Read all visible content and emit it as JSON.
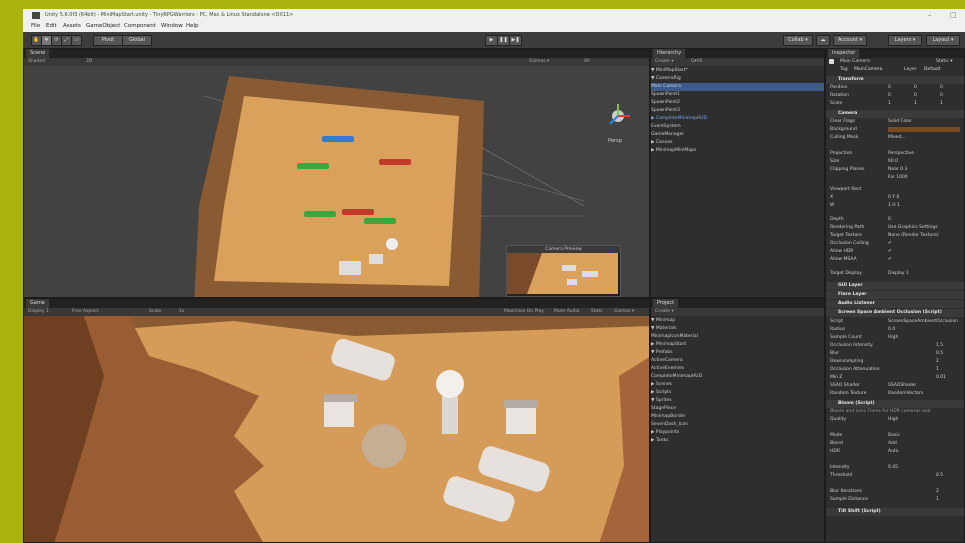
{
  "app": {
    "title": "Unity 5.6.0f3 (64bit) - MiniMapStart.unity - TinyRPGWarriors - PC, Mac & Linux Standalone <DX11>"
  },
  "window_controls": [
    "–",
    "□"
  ],
  "menu": [
    "File",
    "Edit",
    "Assets",
    "GameObject",
    "Component",
    "Window",
    "Help"
  ],
  "toolbar": {
    "pivot": "Pivot",
    "global": "Global",
    "collab": "Collab ▾",
    "cloud": "☁",
    "account": "Account ▾",
    "layers": "Layers ▾",
    "layout": "Layout ▾"
  },
  "scene": {
    "tab": "Scene",
    "shading": "Shaded",
    "mode_2d": "2D",
    "gizmos": "Gizmos ▾",
    "search": "All",
    "persp": "Persp",
    "preview_title": "Camera Preview"
  },
  "game": {
    "tab": "Game",
    "display": "Display 1",
    "aspect": "Free Aspect",
    "scale_label": "Scale",
    "scale_value": "1x",
    "maximize": "Maximize On Play",
    "mute": "Mute Audio",
    "stats": "Stats",
    "gizmos": "Gizmos ▾"
  },
  "hierarchy": {
    "tab": "Hierarchy",
    "create": "Create ▾",
    "search": "Q▾All",
    "items": [
      "▼ MiniMapStart*",
      "  ▼ CameraRig",
      "      Main Camera",
      "    SpawnPoint1",
      "    SpawnPoint2",
      "    SpawnPoint3",
      "  ▶ CompleteMinimapHUD",
      "    EventSystem",
      "    GameManager",
      "  ▶ Canvas",
      "  ▶ MinimapMiniMaps"
    ]
  },
  "project": {
    "tab": "Project",
    "create": "Create ▾",
    "items": [
      "▼ Minimap",
      "  ▼ Materials",
      "      MinimapIconMaterial",
      "  ▶ MinimapStart",
      "  ▼ Prefabs",
      "      ActiveCamera",
      "      ActiveEnemies",
      "      CompleteMinimapHUD",
      "  ▶ Scenes",
      "  ▶ Scripts",
      "  ▼ Sprites",
      "      StagePiece",
      "      MinimapBorder",
      "      SevenDash_Icon",
      "▶ Playpoints",
      "▶ Tanks"
    ]
  },
  "inspector": {
    "tab": "Inspector",
    "object_name": "Main Camera",
    "static": "Static ▾",
    "tag_label": "Tag",
    "tag_value": "MainCamera",
    "layer_label": "Layer",
    "layer_value": "Default",
    "transform": {
      "header": "Transform",
      "rows": [
        {
          "label": "Position",
          "x": "0",
          "y": "0",
          "z": "0"
        },
        {
          "label": "Rotation",
          "x": "0",
          "y": "0",
          "z": "0"
        },
        {
          "label": "Scale",
          "x": "1",
          "y": "1",
          "z": "1"
        }
      ]
    },
    "camera": {
      "header": "Camera",
      "rows": [
        {
          "label": "Clear Flags",
          "value": "Solid Color"
        },
        {
          "label": "Background",
          "value": ""
        },
        {
          "label": "Culling Mask",
          "value": "Mixed..."
        },
        {
          "label": "",
          "value": ""
        },
        {
          "label": "Projection",
          "value": "Perspective"
        },
        {
          "label": "Size",
          "value": "60.0"
        },
        {
          "label": "Clipping Planes",
          "value": "Near  0.3"
        },
        {
          "label": "",
          "value": "Far   1000"
        },
        {
          "label": "Viewport Rect",
          "value": ""
        },
        {
          "label": "  X",
          "value": "0        Y  0"
        },
        {
          "label": "  W",
          "value": "1        H  1"
        },
        {
          "label": "",
          "value": ""
        },
        {
          "label": "Depth",
          "value": "0"
        },
        {
          "label": "Rendering Path",
          "value": "Use Graphics Settings"
        },
        {
          "label": "Target Texture",
          "value": "None (Render Texture)"
        },
        {
          "label": "Occlusion Culling",
          "value": "✔"
        },
        {
          "label": "Allow HDR",
          "value": "✔"
        },
        {
          "label": "Allow MSAA",
          "value": "✔"
        },
        {
          "label": "",
          "value": ""
        },
        {
          "label": "Target Display",
          "value": "Display 1"
        }
      ]
    },
    "components": [
      "GUI Layer",
      "Flare Layer",
      "Audio Listener",
      "Screen Space Ambient Occlusion (Script)"
    ],
    "ssao_rows": [
      {
        "label": "Script",
        "value": "ScreenSpaceAmbientOcclusion"
      },
      {
        "label": "Radius",
        "value": "0.4"
      },
      {
        "label": "Sample Count",
        "value": "High"
      },
      {
        "label": "Occlusion Intensity",
        "value": "1.5"
      },
      {
        "label": "Blur",
        "value": "0.5"
      },
      {
        "label": "Downsampling",
        "value": "2"
      },
      {
        "label": "Occlusion Attenuation",
        "value": "1"
      },
      {
        "label": "Min Z",
        "value": "0.01"
      },
      {
        "label": "SSAO Shader",
        "value": "SSAOShader"
      },
      {
        "label": "Random Texture",
        "value": "RandomVectors"
      }
    ],
    "bloom": {
      "header": "Bloom (Script)",
      "note": "Bloom and Lens Flares for HDR cameras and",
      "rows": [
        {
          "label": "Quality",
          "value": "High"
        },
        {
          "label": "",
          "value": ""
        },
        {
          "label": "Mode",
          "value": "Basic"
        },
        {
          "label": "Blend",
          "value": "Add"
        },
        {
          "label": "HDR",
          "value": "Auto"
        },
        {
          "label": "",
          "value": ""
        },
        {
          "label": "Intensity",
          "value": "0.45"
        },
        {
          "label": "Threshold",
          "value": "0.5"
        },
        {
          "label": "",
          "value": ""
        },
        {
          "label": "Blur Iterations",
          "value": "2"
        },
        {
          "label": "Sample Distance",
          "value": "1"
        }
      ]
    },
    "last_component": "Tilt Shift (Script)"
  },
  "colors": {
    "accent_bg": "#a9b50e",
    "selection": "#3c5b8a",
    "ground": "#d9a15c",
    "rock": "#8a5a33"
  }
}
